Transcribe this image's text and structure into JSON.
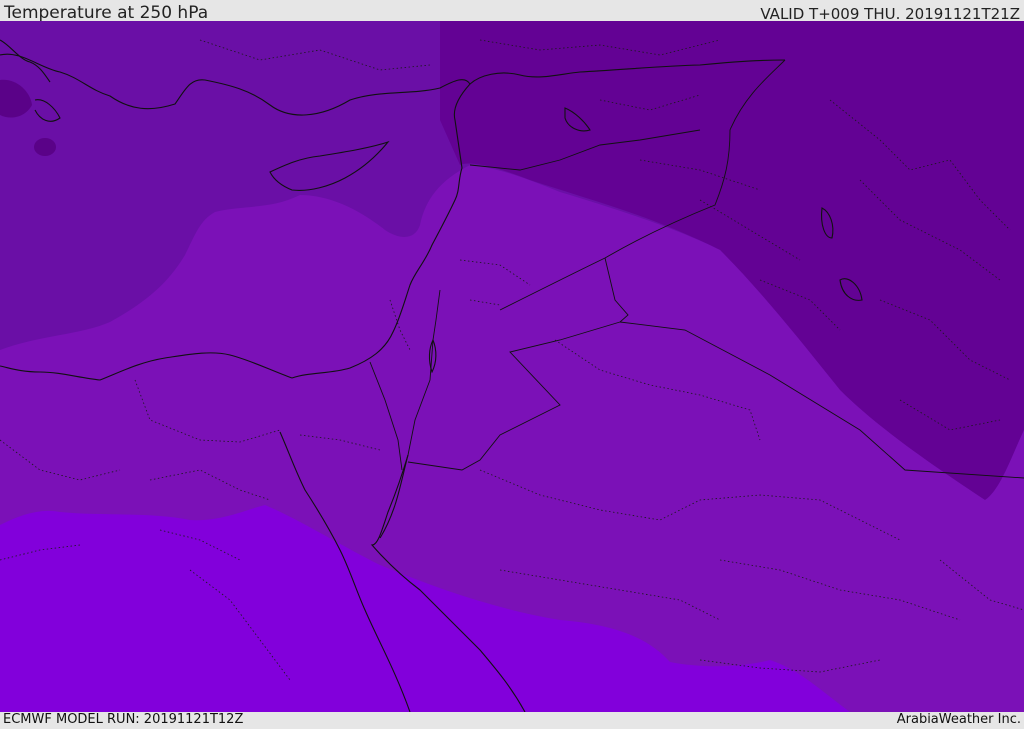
{
  "header": {
    "title": "Temperature at 250 hPa",
    "valid": "VALID T+009 THU. 20191121T21Z"
  },
  "footer": {
    "model_run": "ECMWF MODEL RUN: 20191121T12Z",
    "credit": "ArabiaWeather Inc."
  },
  "colors": {
    "coldest": "#630294",
    "cold": "#6a0fa6",
    "mid": "#7b11b7",
    "warm": "#8200db",
    "lines": "#111111",
    "bar": "#e6e6e6"
  }
}
